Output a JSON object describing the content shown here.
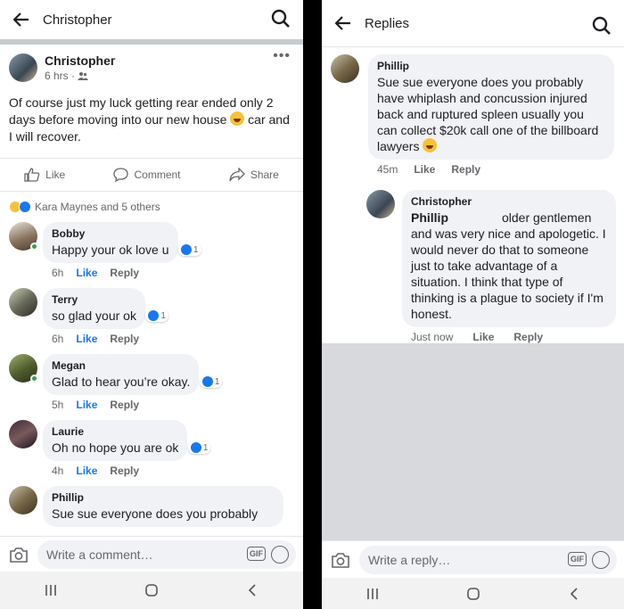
{
  "left": {
    "header_title": "Christopher",
    "post": {
      "author": "Christopheг",
      "time": "6 hrs ·",
      "text": "Of course just my luck getting rear ended only 2 days before moving into our new house",
      "text_after": " car and I will recover.",
      "like_label": "Like",
      "comment_label": "Comment",
      "share_label": "Share",
      "reactions_text": "Kara Maynes and 5 others"
    },
    "comments": [
      {
        "name": "Bobby",
        "text": "Happy your ok love u",
        "time": "6h",
        "like": "Like",
        "reply": "Reply",
        "likes": "1"
      },
      {
        "name": "Terry",
        "text": "so glad your ok",
        "time": "6h",
        "like": "Like",
        "reply": "Reply",
        "likes": "1"
      },
      {
        "name": "Megan",
        "text": "Glad to hear you’re okay.",
        "time": "5h",
        "like": "Like",
        "reply": "Reply",
        "likes": "1"
      },
      {
        "name": "Laurie",
        "text": "Oh no hope you are ok",
        "time": "4h",
        "like": "Like",
        "reply": "Reply",
        "likes": "1"
      },
      {
        "name": "Phillip",
        "text": "Sue sue everyone does you probably"
      }
    ],
    "composer_placeholder": "Write a comment…",
    "gif_label": "GIF"
  },
  "right": {
    "header_title": "Replies",
    "phillip": {
      "name": "Phillip",
      "text": "Sue sue everyone does you probably have whiplash and concussion injured back and ruptured spleen usually you can collect $20k call one of the billboard lawyers",
      "time": "45m",
      "like": "Like",
      "reply": "Reply"
    },
    "christopher": {
      "name": "Christopher",
      "mention": "Phillip",
      "text_first": "older gentlemen",
      "text": "and was very nice and apologetic. I would never do that to someone just to take advantage of a situation. I think that type of thinking is a plague to society if I'm honest.",
      "time": "Just now",
      "like": "Like",
      "reply": "Reply"
    },
    "composer_placeholder": "Write a reply…",
    "gif_label": "GIF"
  }
}
